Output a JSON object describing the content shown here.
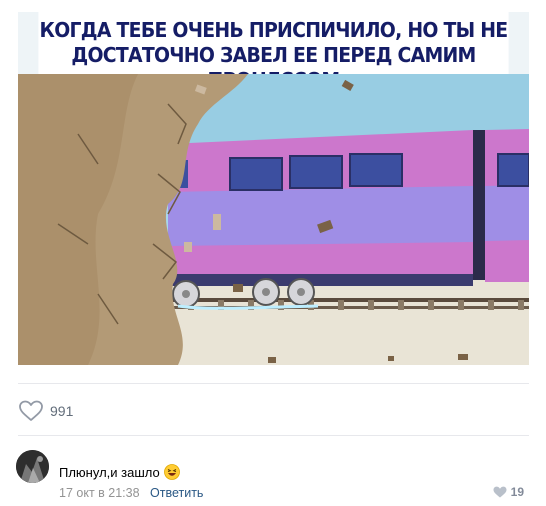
{
  "meme": {
    "caption": "КОГДА ТЕБЕ ОЧЕНЬ ПРИСПИЧИЛО, НО ТЫ НЕ\nДОСТАТОЧНО ЗАВЕЛ ЕЕ ПЕРЕД САМИМ ПРОЦЕССОМ"
  },
  "post": {
    "likes_count": "991"
  },
  "comment": {
    "text": "Плюнул,и зашло",
    "time": "17 окт в 21:38",
    "reply_label": "Ответить",
    "likes_count": "19"
  },
  "colors": {
    "caption": "#151d66",
    "train_pink": "#cc77cc",
    "train_lavender": "#9f8ee6",
    "rock": "#b39a76",
    "sky": "#a8d6ea",
    "link": "#2a5885"
  },
  "icons": {
    "like": "heart-outline-icon",
    "emoji": "laughing-face-emoji",
    "comment_like": "heart-filled-icon"
  }
}
